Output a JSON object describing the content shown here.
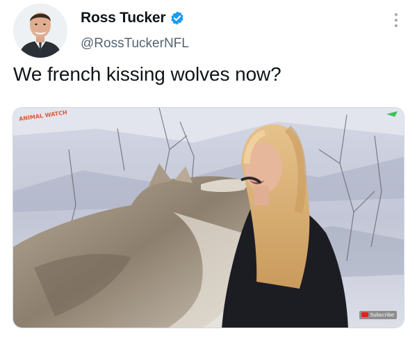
{
  "tweet": {
    "display_name": "Ross Tucker",
    "handle": "@RossTuckerNFL",
    "text": "We french kissing wolves now?",
    "verified": true
  },
  "media": {
    "watermark": "ANIMAL WATCH",
    "subscribe_label": "Subscribe"
  },
  "icons": [
    "avatar",
    "verified-badge-icon",
    "more-options-icon",
    "youtube-icon"
  ],
  "colors": {
    "verified_blue": "#1d9bf0",
    "handle_gray": "#536471",
    "text": "#0f1419"
  }
}
